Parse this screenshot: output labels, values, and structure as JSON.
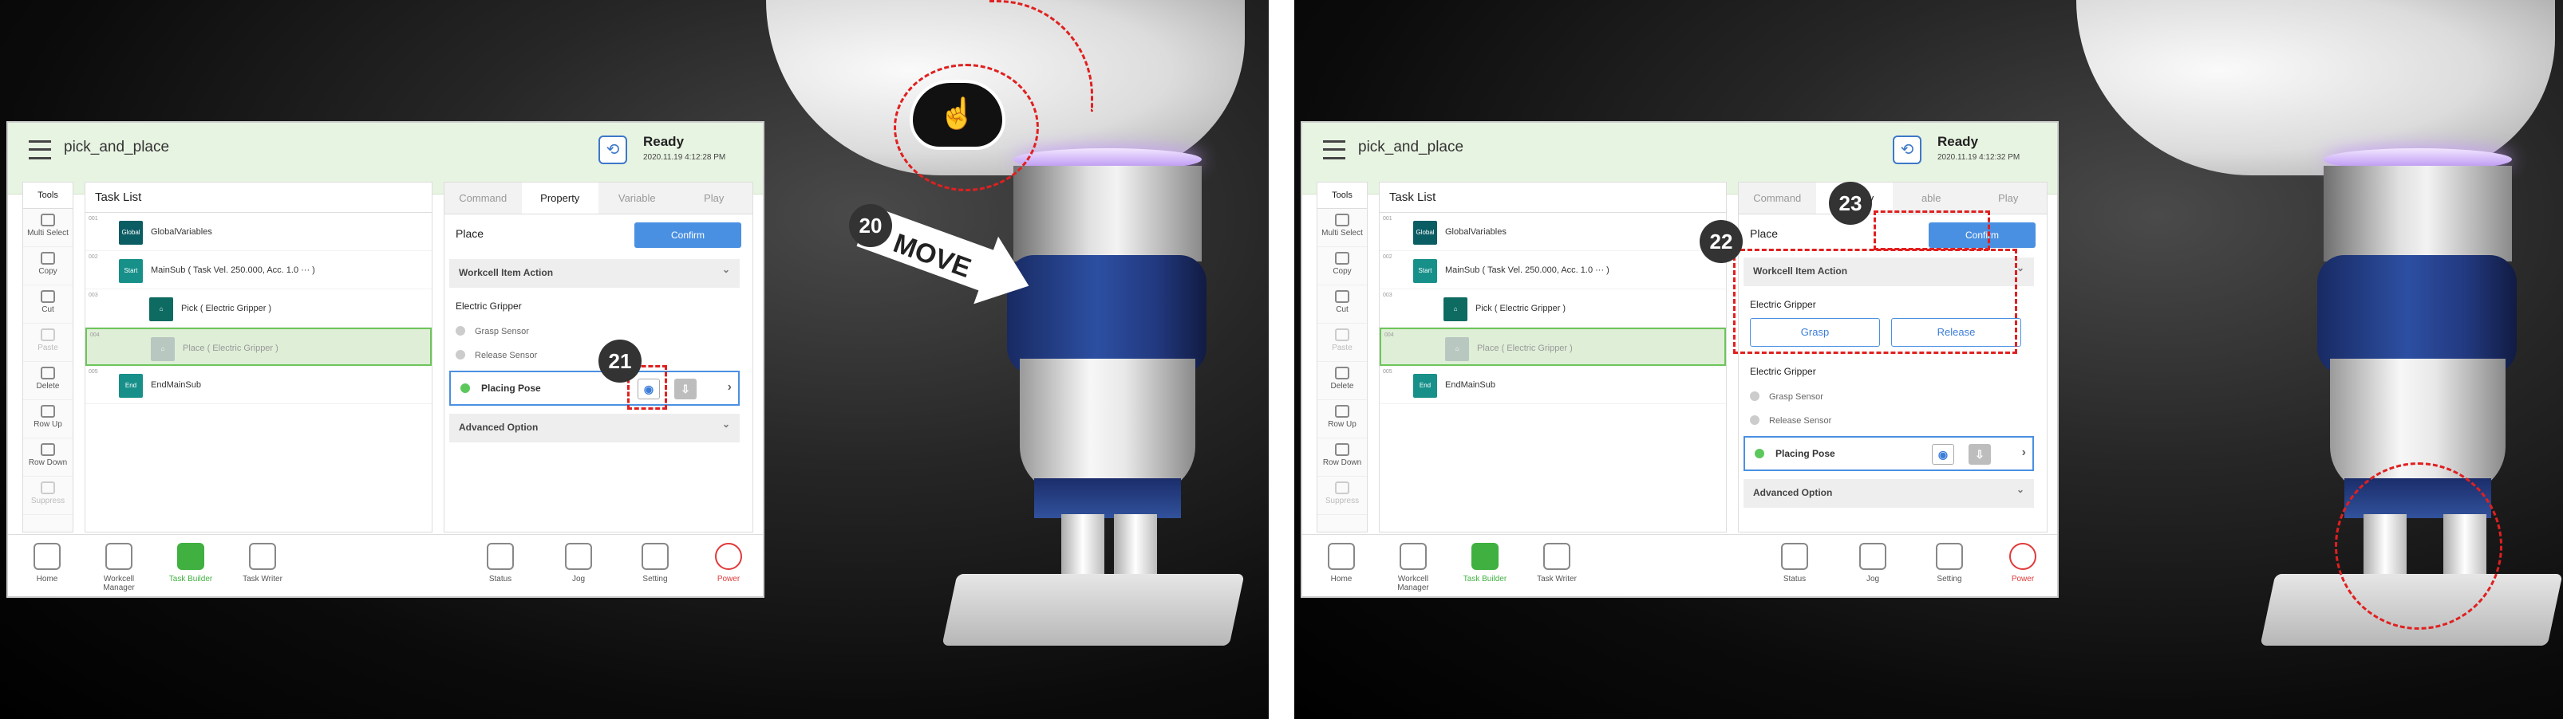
{
  "left": {
    "app_title": "pick_and_place",
    "status": {
      "label": "Ready",
      "time": "2020.11.19 4:12:28 PM"
    },
    "tools": {
      "title": "Tools",
      "items": [
        "Multi Select",
        "Copy",
        "Cut",
        "Paste",
        "Delete",
        "Row Up",
        "Row Down",
        "Suppress"
      ]
    },
    "task_list": {
      "title": "Task List",
      "rows": [
        {
          "num": "001",
          "badge": "Global Var.",
          "label": "GlobalVariables"
        },
        {
          "num": "002",
          "badge": "Start",
          "label": "MainSub ( Task Vel. 250.000, Acc. 1.0 ··· )"
        },
        {
          "num": "003",
          "badge": "",
          "label": "Pick ( Electric Gripper )"
        },
        {
          "num": "004",
          "badge": "",
          "label": "Place ( Electric Gripper )"
        },
        {
          "num": "005",
          "badge": "End",
          "label": "EndMainSub"
        }
      ]
    },
    "tabs": [
      "Command",
      "Property",
      "Variable",
      "Play"
    ],
    "property": {
      "title": "Place",
      "confirm": "Confirm",
      "section": "Workcell Item Action",
      "gripper": "Electric Gripper",
      "sensors": [
        "Grasp Sensor",
        "Release Sensor"
      ],
      "pose": "Placing Pose",
      "advanced": "Advanced Option"
    },
    "bottom_nav": [
      "Home",
      "Workcell Manager",
      "Task Builder",
      "Task Writer",
      "Status",
      "Jog",
      "Setting",
      "Power"
    ],
    "step_move": "20",
    "step_target": "21",
    "move_label": "MOVE"
  },
  "right": {
    "app_title": "pick_and_place",
    "status": {
      "label": "Ready",
      "time": "2020.11.19 4:12:32 PM"
    },
    "tools_title": "Tools",
    "task_title": "Task List",
    "tabs": [
      "Command",
      "Property",
      "able",
      "Play"
    ],
    "property": {
      "title": "Place",
      "confirm": "Confirm",
      "section": "Workcell Item Action",
      "gripper1": "Electric Gripper",
      "grasp": "Grasp",
      "release": "Release",
      "gripper2": "Electric Gripper",
      "sensors": [
        "Grasp Sensor",
        "Release Sensor"
      ],
      "pose": "Placing Pose",
      "advanced": "Advanced Option"
    },
    "step_action": "22",
    "step_confirm": "23"
  },
  "colors": {
    "accent": "#4a90e2",
    "highlight": "#e02020",
    "active": "#40b040",
    "header": "#e8f4e2"
  }
}
